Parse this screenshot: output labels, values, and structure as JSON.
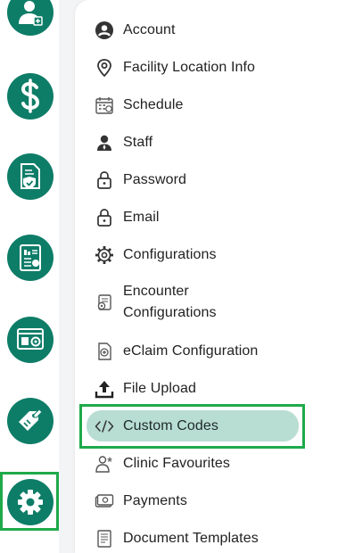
{
  "rail": {
    "items": [
      {
        "name": "add-doctor-icon"
      },
      {
        "name": "dollar-icon"
      },
      {
        "name": "insurance-document-icon"
      },
      {
        "name": "reports-icon"
      },
      {
        "name": "dashboard-settings-icon"
      },
      {
        "name": "edit-tag-icon"
      },
      {
        "name": "gear-icon",
        "active": true
      }
    ]
  },
  "menu": {
    "items": [
      {
        "label": "Account",
        "icon": "account-icon"
      },
      {
        "label": "Facility Location Info",
        "icon": "location-pin-icon"
      },
      {
        "label": "Schedule",
        "icon": "calendar-icon"
      },
      {
        "label": "Staff",
        "icon": "staff-icon"
      },
      {
        "label": "Password",
        "icon": "lock-icon"
      },
      {
        "label": "Email",
        "icon": "lock-icon"
      },
      {
        "label": "Configurations",
        "icon": "gear-icon"
      },
      {
        "label_line1": "Encounter",
        "label_line2": "Configurations",
        "icon": "encounter-config-icon"
      },
      {
        "label": "eClaim Configuration",
        "icon": "eclaim-icon"
      },
      {
        "label": "File Upload",
        "icon": "upload-icon"
      },
      {
        "label": "Custom Codes",
        "icon": "code-icon",
        "active": true
      },
      {
        "label": "Clinic Favourites",
        "icon": "clinic-favourites-icon"
      },
      {
        "label": "Payments",
        "icon": "payments-icon"
      },
      {
        "label": "Document Templates",
        "icon": "document-template-icon"
      }
    ]
  },
  "colors": {
    "rail_accent": "#0e7d68",
    "active_highlight": "#b8ddd2",
    "annotation_frame": "#1faa4a"
  }
}
